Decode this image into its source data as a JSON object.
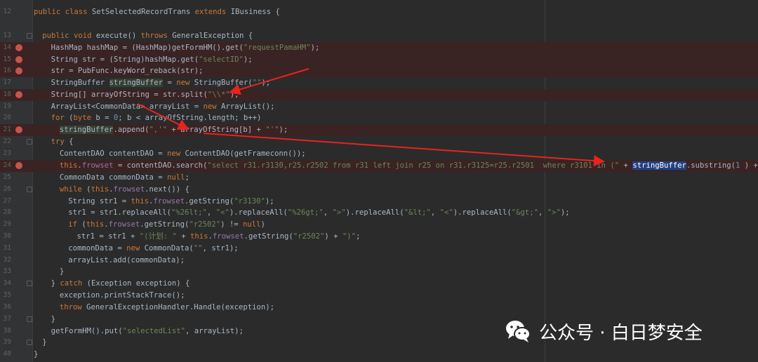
{
  "editor": {
    "lines": [
      {
        "n": "12",
        "bp": false,
        "fold": false,
        "indent": 0,
        "tokens": [
          [
            "kw",
            "public class "
          ],
          [
            "",
            "SetSelectedRecordTrans "
          ],
          [
            "kw",
            "extends "
          ],
          [
            "",
            "IBusiness {"
          ]
        ]
      },
      {
        "n": "13",
        "bp": false,
        "fold": true,
        "indent": 1,
        "tokens": [
          [
            "kw",
            "public void "
          ],
          [
            "",
            "execute() "
          ],
          [
            "kw",
            "throws "
          ],
          [
            "",
            "GeneralException {"
          ]
        ]
      },
      {
        "n": "14",
        "bp": true,
        "fold": false,
        "indent": 2,
        "tokens": [
          [
            "",
            "HashMap hashMap = (HashMap)getFormHM().get("
          ],
          [
            "str",
            "\"requestPamaHM\""
          ],
          [
            "",
            ");"
          ]
        ]
      },
      {
        "n": "15",
        "bp": true,
        "fold": false,
        "indent": 2,
        "tokens": [
          [
            "",
            "String str = (String)hashMap.get("
          ],
          [
            "str",
            "\"selectID\""
          ],
          [
            "",
            ");"
          ]
        ]
      },
      {
        "n": "16",
        "bp": true,
        "fold": false,
        "indent": 2,
        "tokens": [
          [
            "",
            "str = PubFunc.keyWord_reback(str);"
          ]
        ]
      },
      {
        "n": "17",
        "bp": false,
        "fold": false,
        "indent": 2,
        "tokens": [
          [
            "",
            "StringBuffer "
          ],
          [
            "hl",
            "stringBuffer"
          ],
          [
            "",
            " = "
          ],
          [
            "kw",
            "new "
          ],
          [
            "",
            "StringBuffer("
          ],
          [
            "str",
            "\"\""
          ],
          [
            "",
            ");"
          ]
        ]
      },
      {
        "n": "18",
        "bp": true,
        "fold": false,
        "indent": 2,
        "tokens": [
          [
            "",
            "String[] arrayOfString = str.split("
          ],
          [
            "str",
            "\"\\\\*\""
          ],
          [
            "",
            ");"
          ]
        ]
      },
      {
        "n": "19",
        "bp": false,
        "fold": false,
        "indent": 2,
        "tokens": [
          [
            "",
            "ArrayList<CommonData> arrayList = "
          ],
          [
            "kw",
            "new "
          ],
          [
            "",
            "ArrayList();"
          ]
        ]
      },
      {
        "n": "20",
        "bp": false,
        "fold": false,
        "indent": 2,
        "tokens": [
          [
            "kw",
            "for "
          ],
          [
            "",
            "("
          ],
          [
            "kw",
            "byte "
          ],
          [
            "",
            "b = "
          ],
          [
            "num",
            "0"
          ],
          [
            "",
            "; b < arrayOfString.length; b++)"
          ]
        ]
      },
      {
        "n": "21",
        "bp": true,
        "fold": false,
        "indent": 3,
        "tokens": [
          [
            "hl",
            "stringBuffer"
          ],
          [
            "",
            ".append("
          ],
          [
            "str",
            "\",'\""
          ],
          [
            "",
            " + arrayOfString[b] + "
          ],
          [
            "str",
            "\"'\""
          ],
          [
            "",
            ");"
          ]
        ]
      },
      {
        "n": "22",
        "bp": false,
        "fold": true,
        "indent": 2,
        "tokens": [
          [
            "kw",
            "try "
          ],
          [
            "",
            "{"
          ]
        ]
      },
      {
        "n": "23",
        "bp": false,
        "fold": false,
        "indent": 3,
        "tokens": [
          [
            "",
            "ContentDAO contentDAO = "
          ],
          [
            "kw",
            "new "
          ],
          [
            "",
            "ContentDAO(getFrameconn());"
          ]
        ]
      },
      {
        "n": "24",
        "bp": true,
        "fold": false,
        "indent": 3,
        "tokens": [
          [
            "kw",
            "this"
          ],
          [
            "",
            "."
          ],
          [
            "fld",
            "frowset"
          ],
          [
            "",
            " = contentDAO.search("
          ],
          [
            "str",
            "\"select r31.r3130,r25.r2502 from r31 left join r25 on r31.r3125=r25.r2501  where r3101 in (\""
          ],
          [
            "",
            " + "
          ],
          [
            "sel",
            "stringBuffer"
          ],
          [
            "",
            ".substring("
          ],
          [
            "num",
            "1"
          ],
          [
            "",
            " ) + "
          ],
          [
            "str",
            "\")\""
          ],
          [
            "",
            ");"
          ]
        ]
      },
      {
        "n": "25",
        "bp": false,
        "fold": false,
        "indent": 3,
        "tokens": [
          [
            "",
            "CommonData commonData = "
          ],
          [
            "kw",
            "null"
          ],
          [
            "",
            ";"
          ]
        ]
      },
      {
        "n": "26",
        "bp": false,
        "fold": true,
        "indent": 3,
        "tokens": [
          [
            "kw",
            "while "
          ],
          [
            "",
            "("
          ],
          [
            "kw",
            "this"
          ],
          [
            "",
            "."
          ],
          [
            "fld",
            "frowset"
          ],
          [
            "",
            ".next()) {"
          ]
        ]
      },
      {
        "n": "27",
        "bp": false,
        "fold": false,
        "indent": 4,
        "tokens": [
          [
            "",
            "String str1 = "
          ],
          [
            "kw",
            "this"
          ],
          [
            "",
            "."
          ],
          [
            "fld",
            "frowset"
          ],
          [
            "",
            ".getString("
          ],
          [
            "str",
            "\"r3130\""
          ],
          [
            "",
            ");"
          ]
        ]
      },
      {
        "n": "28",
        "bp": false,
        "fold": false,
        "indent": 4,
        "tokens": [
          [
            "",
            "str1 = str1.replaceAll("
          ],
          [
            "str",
            "\"%26lt;\""
          ],
          [
            "",
            ", "
          ],
          [
            "str",
            "\"<\""
          ],
          [
            "",
            ").replaceAll("
          ],
          [
            "str",
            "\"%26gt;\""
          ],
          [
            "",
            ", "
          ],
          [
            "str",
            "\">\""
          ],
          [
            "",
            ").replaceAll("
          ],
          [
            "str",
            "\"&lt;\""
          ],
          [
            "",
            ", "
          ],
          [
            "str",
            "\"<\""
          ],
          [
            "",
            ").replaceAll("
          ],
          [
            "str",
            "\"&gt;\""
          ],
          [
            "",
            ", "
          ],
          [
            "str",
            "\">\""
          ],
          [
            "",
            ");"
          ]
        ]
      },
      {
        "n": "29",
        "bp": false,
        "fold": false,
        "indent": 4,
        "tokens": [
          [
            "kw",
            "if "
          ],
          [
            "",
            "("
          ],
          [
            "kw",
            "this"
          ],
          [
            "",
            "."
          ],
          [
            "fld",
            "frowset"
          ],
          [
            "",
            ".getString("
          ],
          [
            "str",
            "\"r2502\""
          ],
          [
            "",
            ") != "
          ],
          [
            "kw",
            "null"
          ],
          [
            "",
            ")"
          ]
        ]
      },
      {
        "n": "30",
        "bp": false,
        "fold": false,
        "indent": 5,
        "tokens": [
          [
            "",
            "str1 = str1 + "
          ],
          [
            "str",
            "\"(计划: \""
          ],
          [
            "",
            " + "
          ],
          [
            "kw",
            "this"
          ],
          [
            "",
            "."
          ],
          [
            "fld",
            "frowset"
          ],
          [
            "",
            ".getString("
          ],
          [
            "str",
            "\"r2502\""
          ],
          [
            "",
            ") + "
          ],
          [
            "str",
            "\")\""
          ],
          [
            "",
            ";"
          ]
        ]
      },
      {
        "n": "31",
        "bp": false,
        "fold": false,
        "indent": 4,
        "tokens": [
          [
            "",
            "commonData = "
          ],
          [
            "kw",
            "new "
          ],
          [
            "",
            "CommonData("
          ],
          [
            "str",
            "\"\""
          ],
          [
            "",
            ", str1);"
          ]
        ]
      },
      {
        "n": "32",
        "bp": false,
        "fold": false,
        "indent": 4,
        "tokens": [
          [
            "",
            "arrayList.add(commonData);"
          ]
        ]
      },
      {
        "n": "33",
        "bp": false,
        "fold": false,
        "indent": 3,
        "tokens": [
          [
            "",
            "}"
          ]
        ]
      },
      {
        "n": "34",
        "bp": false,
        "fold": true,
        "indent": 2,
        "tokens": [
          [
            "",
            "} "
          ],
          [
            "kw",
            "catch "
          ],
          [
            "",
            "(Exception exception) {"
          ]
        ]
      },
      {
        "n": "35",
        "bp": false,
        "fold": false,
        "indent": 3,
        "tokens": [
          [
            "",
            "exception.printStackTrace();"
          ]
        ]
      },
      {
        "n": "36",
        "bp": false,
        "fold": false,
        "indent": 3,
        "tokens": [
          [
            "kw",
            "throw "
          ],
          [
            "",
            "GeneralExceptionHandler.Handle(exception);"
          ]
        ]
      },
      {
        "n": "37",
        "bp": false,
        "fold": true,
        "indent": 2,
        "tokens": [
          [
            "",
            "}"
          ]
        ]
      },
      {
        "n": "38",
        "bp": false,
        "fold": false,
        "indent": 2,
        "tokens": [
          [
            "",
            "getFormHM().put("
          ],
          [
            "str",
            "\"selectedList\""
          ],
          [
            "",
            ", arrayList);"
          ]
        ]
      },
      {
        "n": "39",
        "bp": false,
        "fold": true,
        "indent": 1,
        "tokens": [
          [
            "",
            "}"
          ]
        ]
      },
      {
        "n": "40",
        "bp": false,
        "fold": false,
        "indent": 0,
        "tokens": [
          [
            "",
            "}"
          ]
        ]
      }
    ]
  },
  "watermark": {
    "text": "公众号 · 白日梦安全",
    "icon": "wechat-icon"
  },
  "colors": {
    "arrow": "#e8231e",
    "breakpoint": "#c75450",
    "selection": "#214283"
  }
}
